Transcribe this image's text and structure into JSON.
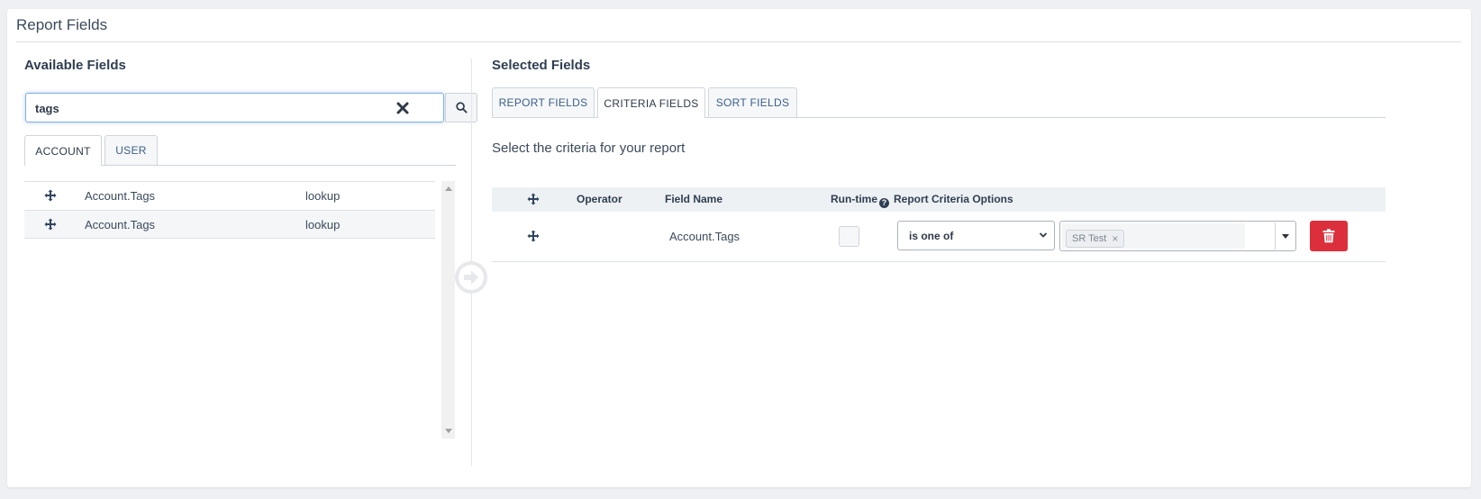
{
  "panel": {
    "title": "Report Fields"
  },
  "available": {
    "title": "Available Fields",
    "search": {
      "value": "tags",
      "placeholder": ""
    },
    "tabs": [
      {
        "label": "ACCOUNT",
        "active": true
      },
      {
        "label": "USER",
        "active": false
      }
    ],
    "fields": [
      {
        "name": "Account.Tags",
        "type": "lookup"
      },
      {
        "name": "Account.Tags",
        "type": "lookup"
      }
    ]
  },
  "selected": {
    "title": "Selected Fields",
    "tabs": [
      {
        "label": "REPORT FIELDS",
        "active": false
      },
      {
        "label": "CRITERIA FIELDS",
        "active": true
      },
      {
        "label": "SORT FIELDS",
        "active": false
      }
    ],
    "instructions": "Select the criteria for your report",
    "table": {
      "headers": {
        "operator": "Operator",
        "field_name": "Field Name",
        "runtime": "Run-time",
        "options": "Report Criteria Options"
      },
      "rows": [
        {
          "field_name": "Account.Tags",
          "runtime": false,
          "operator": "is one of",
          "tags": [
            "SR Test"
          ]
        }
      ]
    }
  },
  "colors": {
    "accent": "#3c5f88",
    "danger": "#dc2f3c",
    "focus": "#7fb0e0"
  },
  "icons": [
    "clear-icon",
    "search-icon",
    "move-icon",
    "arrow-right-circle-icon",
    "help-icon",
    "chevron-down-icon",
    "trash-icon"
  ]
}
